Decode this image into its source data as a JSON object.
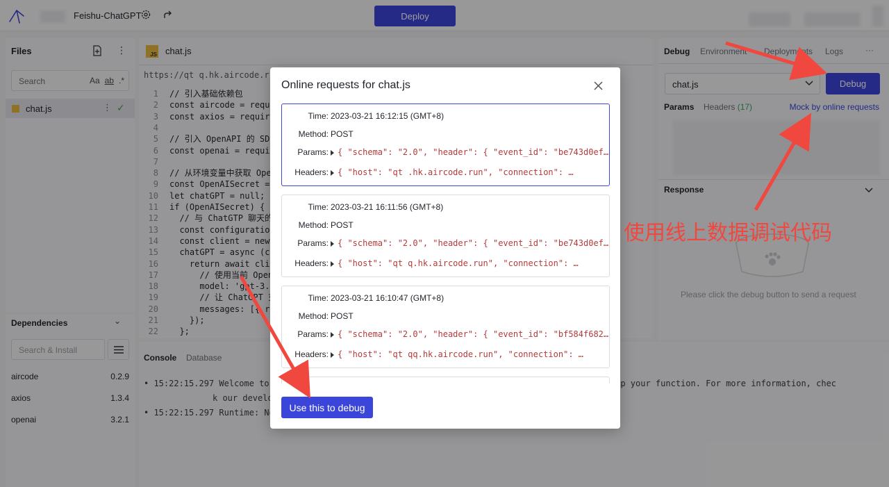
{
  "topbar": {
    "app_title": "Feishu-ChatGPT",
    "deploy_label": "Deploy"
  },
  "files": {
    "title": "Files",
    "search_placeholder": "Search",
    "search_options": [
      "Aa",
      "ab",
      ".*"
    ],
    "items": [
      {
        "name": "chat.js"
      }
    ]
  },
  "dependencies": {
    "title": "Dependencies",
    "search_placeholder": "Search & Install",
    "items": [
      {
        "name": "aircode",
        "version": "0.2.9"
      },
      {
        "name": "axios",
        "version": "1.3.4"
      },
      {
        "name": "openai",
        "version": "3.2.1"
      }
    ]
  },
  "editor": {
    "tab_label": "chat.js",
    "tab_badge": "JS",
    "url": "https://qt            q.hk.aircode.r",
    "lines": [
      {
        "n": "1",
        "text": "// 引入基础依赖包"
      },
      {
        "n": "2",
        "text": "const aircode = requi"
      },
      {
        "n": "3",
        "text": "const axios = require"
      },
      {
        "n": "4",
        "text": ""
      },
      {
        "n": "5",
        "text": "// 引入 OpenAPI 的 SDK"
      },
      {
        "n": "6",
        "text": "const openai = requir"
      },
      {
        "n": "7",
        "text": ""
      },
      {
        "n": "8",
        "text": "// 从环境变量中获取 Oper"
      },
      {
        "n": "9",
        "text": "const OpenAISecret ="
      },
      {
        "n": "10",
        "text": "let chatGPT = null;"
      },
      {
        "n": "11",
        "text": "if (OpenAISecret) {"
      },
      {
        "n": "12",
        "text": "  // 与 ChatGTP 聊天的"
      },
      {
        "n": "13",
        "text": "  const configuration"
      },
      {
        "n": "14",
        "text": "  const client = new"
      },
      {
        "n": "15",
        "text": "  chatGPT = async (co"
      },
      {
        "n": "16",
        "text": "    return await clie"
      },
      {
        "n": "17",
        "text": "      // 使用当前 Open"
      },
      {
        "n": "18",
        "text": "      model: 'gpt-3.5"
      },
      {
        "n": "19",
        "text": "      // 让 ChatGPT 充"
      },
      {
        "n": "20",
        "text": "      messages: [{ ro"
      },
      {
        "n": "21",
        "text": "    });"
      },
      {
        "n": "22",
        "text": "  };"
      }
    ]
  },
  "console": {
    "tabs": [
      "Console",
      "Database"
    ],
    "logs": [
      {
        "time": "15:22:15.297",
        "text": "Welcome to A                                                         tton to ship your function. For more information, chec"
      },
      {
        "time": "",
        "text": "k our develo"
      },
      {
        "time": "15:22:15.297",
        "text": "Runtime: Nod"
      }
    ]
  },
  "debug_panel": {
    "tabs": [
      "Debug",
      "Environment",
      "Deployments",
      "Logs"
    ],
    "more": "···",
    "selected_file": "chat.js",
    "debug_label": "Debug",
    "sub_tabs": {
      "params": "Params",
      "headers": "Headers",
      "headers_count": "(17)",
      "mock": "Mock by online requests"
    },
    "response_title": "Response",
    "empty_text": "Please click the debug button to send a request"
  },
  "modal": {
    "title": "Online requests for chat.js",
    "labels": {
      "time": "Time:",
      "method": "Method:",
      "params": "Params:",
      "headers": "Headers:"
    },
    "requests": [
      {
        "time": "2023-03-21 16:12:15 (GMT+8)",
        "method": "POST",
        "params": "{ \"schema\": \"2.0\", \"header\": { \"event_id\": \"be743d0ef…",
        "headers": "{ \"host\": \"qt        .hk.aircode.run\", \"connection\": …"
      },
      {
        "time": "2023-03-21 16:11:56 (GMT+8)",
        "method": "POST",
        "params": "{ \"schema\": \"2.0\", \"header\": { \"event_id\": \"be743d0ef…",
        "headers": "{ \"host\": \"qt        q.hk.aircode.run\", \"connection\": …"
      },
      {
        "time": "2023-03-21 16:10:47 (GMT+8)",
        "method": "POST",
        "params": "{ \"schema\": \"2.0\", \"header\": { \"event_id\": \"bf584f682…",
        "headers": "{ \"host\": \"qt       qq.hk.aircode.run\", \"connection\": …"
      }
    ],
    "use_button": "Use this to debug"
  },
  "annotation": "使用线上数据调试代码",
  "colors": {
    "accent": "#3b45d9",
    "arrow": "#f0473f",
    "json_key": "#b33a3a"
  }
}
